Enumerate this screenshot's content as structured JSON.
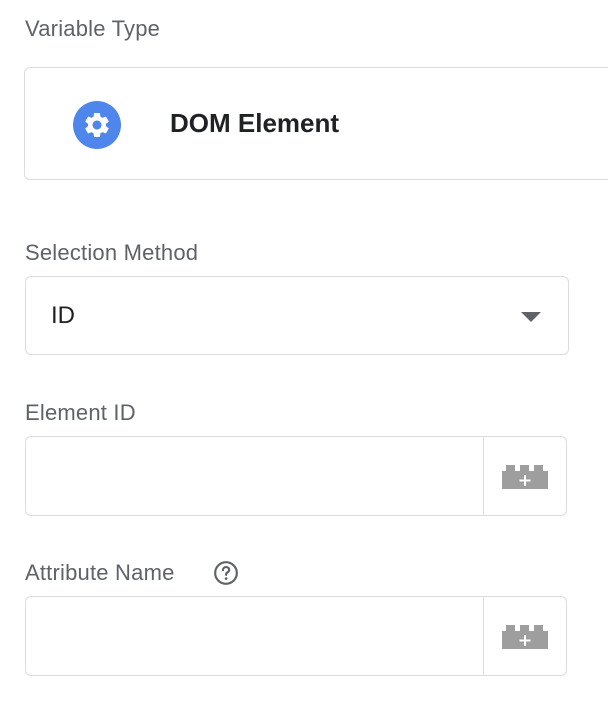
{
  "variable_type": {
    "label": "Variable Type",
    "selected": {
      "name": "DOM Element",
      "icon": "gear-icon",
      "icon_color": "#4f86ec"
    }
  },
  "selection_method": {
    "label": "Selection Method",
    "value": "ID",
    "icon": "dropdown-caret-icon"
  },
  "element_id": {
    "label": "Element ID",
    "value": "",
    "placeholder": "",
    "variable_button_icon": "lego-brick-plus-icon"
  },
  "attribute_name": {
    "label": "Attribute Name",
    "help_icon": "help-circle-icon",
    "value": "",
    "placeholder": "",
    "variable_button_icon": "lego-brick-plus-icon"
  },
  "colors": {
    "label_text": "#5f6368",
    "border": "#dadce0",
    "accent": "#4f86ec",
    "icon_gray": "#9e9e9e"
  }
}
